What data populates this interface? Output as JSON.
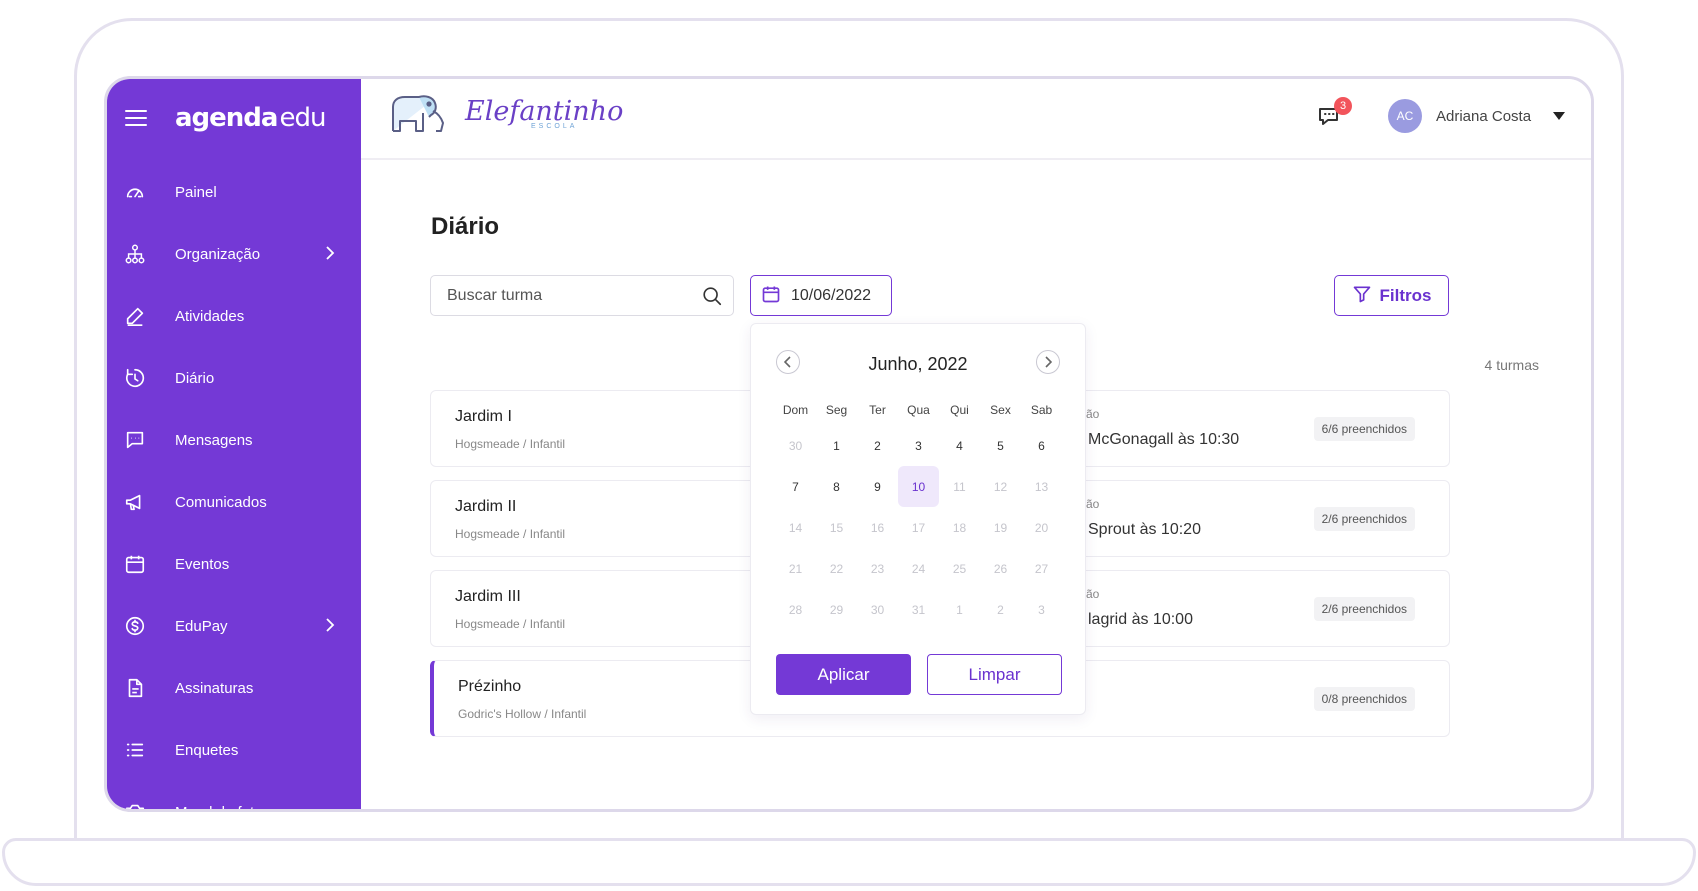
{
  "sidebar": {
    "brand_bold": "agenda",
    "brand_light": "edu",
    "items": [
      {
        "label": "Painel",
        "icon": "gauge-icon"
      },
      {
        "label": "Organização",
        "icon": "org-chart-icon",
        "has_submenu": true
      },
      {
        "label": "Atividades",
        "icon": "pencil-icon"
      },
      {
        "label": "Diário",
        "icon": "timer-icon"
      },
      {
        "label": "Mensagens",
        "icon": "chat-icon"
      },
      {
        "label": "Comunicados",
        "icon": "megaphone-icon"
      },
      {
        "label": "Eventos",
        "icon": "calendar-icon"
      },
      {
        "label": "EduPay",
        "icon": "dollar-icon",
        "has_submenu": true
      },
      {
        "label": "Assinaturas",
        "icon": "document-icon"
      },
      {
        "label": "Enquetes",
        "icon": "list-icon"
      },
      {
        "label": "Mural de fotos",
        "icon": "camera-icon"
      }
    ]
  },
  "header": {
    "school_name": "Elefantinho",
    "school_sub": "ESCOLA",
    "notification_count": "3",
    "user_initials": "AC",
    "user_name": "Adriana Costa"
  },
  "page": {
    "title": "Diário",
    "search_placeholder": "Buscar turma",
    "date_value": "10/06/2022",
    "filters_label": "Filtros",
    "count_label": "4 turmas"
  },
  "classes": [
    {
      "name": "Jardim I",
      "sub": "Hogsmeade / Infantil",
      "label_fragment": "ão",
      "time_fragment": "McGonagall às 10:30",
      "badge": "6/6 preenchidos"
    },
    {
      "name": "Jardim II",
      "sub": "Hogsmeade / Infantil",
      "label_fragment": "ão",
      "time_fragment": "Sprout às 10:20",
      "badge": "2/6 preenchidos"
    },
    {
      "name": "Jardim III",
      "sub": "Hogsmeade / Infantil",
      "label_fragment": "ão",
      "time_fragment": "lagrid às 10:00",
      "badge": "2/6 preenchidos"
    },
    {
      "name": "Prézinho",
      "sub": "Godric's Hollow / Infantil",
      "label_fragment": "",
      "time_fragment": "",
      "badge": "0/8 preenchidos"
    }
  ],
  "calendar": {
    "month_label": "Junho, 2022",
    "weekdays": [
      "Dom",
      "Seg",
      "Ter",
      "Qua",
      "Qui",
      "Sex",
      "Sab"
    ],
    "days": [
      {
        "d": "30",
        "muted": true
      },
      {
        "d": "1"
      },
      {
        "d": "2"
      },
      {
        "d": "3"
      },
      {
        "d": "4"
      },
      {
        "d": "5"
      },
      {
        "d": "6"
      },
      {
        "d": "7"
      },
      {
        "d": "8"
      },
      {
        "d": "9"
      },
      {
        "d": "10",
        "selected": true
      },
      {
        "d": "11",
        "muted": true
      },
      {
        "d": "12",
        "muted": true
      },
      {
        "d": "13",
        "muted": true
      },
      {
        "d": "14",
        "muted": true
      },
      {
        "d": "15",
        "muted": true
      },
      {
        "d": "16",
        "muted": true
      },
      {
        "d": "17",
        "muted": true
      },
      {
        "d": "18",
        "muted": true
      },
      {
        "d": "19",
        "muted": true
      },
      {
        "d": "20",
        "muted": true
      },
      {
        "d": "21",
        "muted": true
      },
      {
        "d": "22",
        "muted": true
      },
      {
        "d": "23",
        "muted": true
      },
      {
        "d": "24",
        "muted": true
      },
      {
        "d": "25",
        "muted": true
      },
      {
        "d": "26",
        "muted": true
      },
      {
        "d": "27",
        "muted": true
      },
      {
        "d": "28",
        "muted": true
      },
      {
        "d": "29",
        "muted": true
      },
      {
        "d": "30",
        "muted": true
      },
      {
        "d": "31",
        "muted": true
      },
      {
        "d": "1",
        "muted": true
      },
      {
        "d": "2",
        "muted": true
      },
      {
        "d": "3",
        "muted": true
      }
    ],
    "apply_label": "Aplicar",
    "clear_label": "Limpar"
  },
  "colors": {
    "primary": "#7439d6",
    "selected_day_bg": "#efe8fb",
    "badge_red": "#f2545b"
  }
}
